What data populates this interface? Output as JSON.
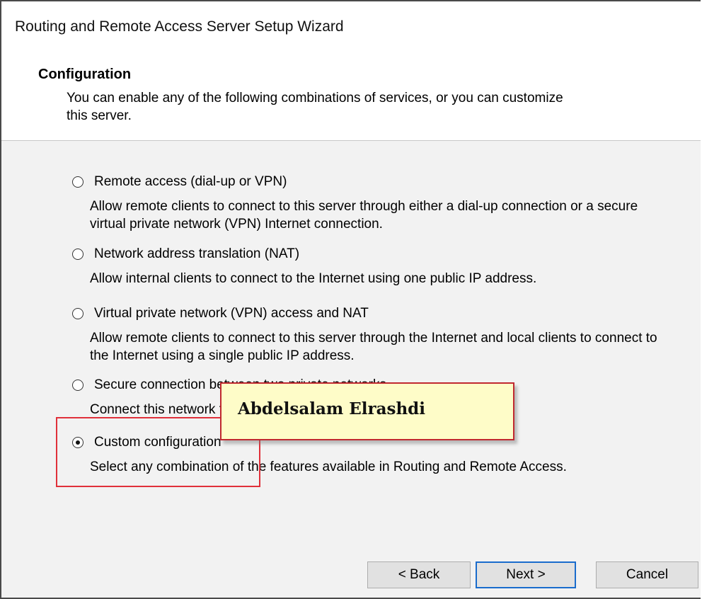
{
  "window": {
    "title": "Routing and Remote Access Server Setup Wizard"
  },
  "header": {
    "heading": "Configuration",
    "description": "You can enable any of the following combinations of services, or you can customize this server."
  },
  "options": [
    {
      "label": "Remote access (dial-up or VPN)",
      "description": "Allow remote clients to connect to this server through either a dial-up connection or a secure virtual private network (VPN) Internet connection.",
      "checked": false
    },
    {
      "label": "Network address translation (NAT)",
      "description": "Allow internal clients to connect to the Internet using one public IP address.",
      "checked": false
    },
    {
      "label": "Virtual private network (VPN) access and NAT",
      "description": "Allow remote clients to connect to this server through the Internet and local clients to connect to the Internet using a single public IP address.",
      "checked": false
    },
    {
      "label": "Secure connection between two private networks",
      "description": "Connect this network to a remote network, such as a branch office.",
      "checked": false
    },
    {
      "label": "Custom configuration",
      "description": "Select any combination of the features available in Routing and Remote Access.",
      "checked": true
    }
  ],
  "buttons": {
    "back": "< Back",
    "next": "Next >",
    "cancel": "Cancel"
  },
  "watermark": {
    "text": "Abdelsalam Elrashdi"
  },
  "colors": {
    "highlight_border": "#e0303a",
    "watermark_bg": "#fefcc8",
    "default_button_border": "#1a6ccc"
  }
}
